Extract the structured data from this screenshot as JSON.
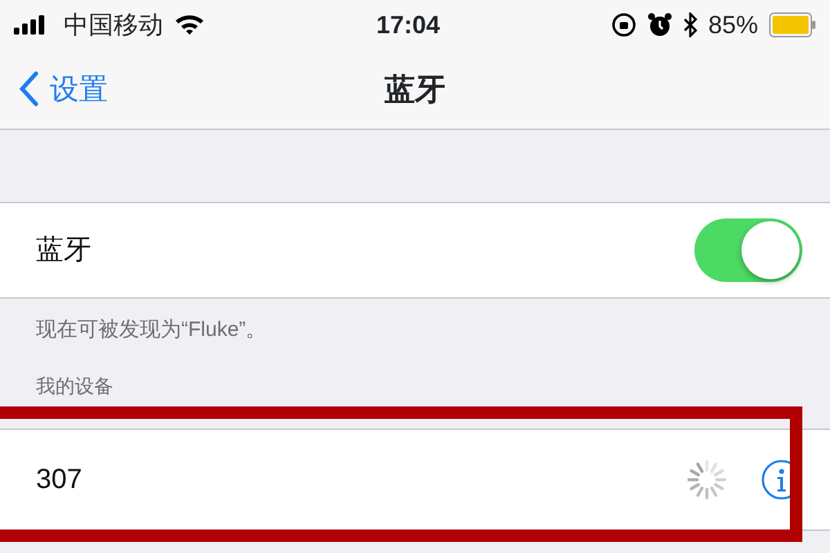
{
  "status_bar": {
    "carrier": "中国移动",
    "time": "17:04",
    "battery": "85%"
  },
  "nav": {
    "back": "设置",
    "title": "蓝牙"
  },
  "bluetooth": {
    "label": "蓝牙",
    "on": true,
    "footer": "现在可被发现为“Fluke”。"
  },
  "my_devices": {
    "header": "我的设备",
    "devices": [
      {
        "name": "307",
        "connecting": true
      }
    ]
  },
  "annotation": {
    "kind": "highlight-box"
  }
}
